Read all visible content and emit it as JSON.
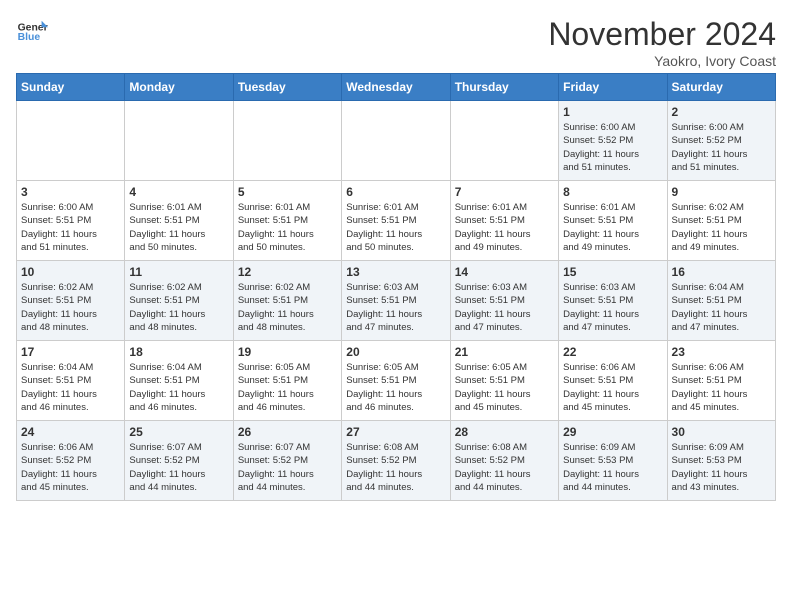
{
  "header": {
    "logo_line1": "General",
    "logo_line2": "Blue",
    "month": "November 2024",
    "location": "Yaokro, Ivory Coast"
  },
  "weekdays": [
    "Sunday",
    "Monday",
    "Tuesday",
    "Wednesday",
    "Thursday",
    "Friday",
    "Saturday"
  ],
  "weeks": [
    [
      {
        "day": "",
        "info": ""
      },
      {
        "day": "",
        "info": ""
      },
      {
        "day": "",
        "info": ""
      },
      {
        "day": "",
        "info": ""
      },
      {
        "day": "",
        "info": ""
      },
      {
        "day": "1",
        "info": "Sunrise: 6:00 AM\nSunset: 5:52 PM\nDaylight: 11 hours\nand 51 minutes."
      },
      {
        "day": "2",
        "info": "Sunrise: 6:00 AM\nSunset: 5:52 PM\nDaylight: 11 hours\nand 51 minutes."
      }
    ],
    [
      {
        "day": "3",
        "info": "Sunrise: 6:00 AM\nSunset: 5:51 PM\nDaylight: 11 hours\nand 51 minutes."
      },
      {
        "day": "4",
        "info": "Sunrise: 6:01 AM\nSunset: 5:51 PM\nDaylight: 11 hours\nand 50 minutes."
      },
      {
        "day": "5",
        "info": "Sunrise: 6:01 AM\nSunset: 5:51 PM\nDaylight: 11 hours\nand 50 minutes."
      },
      {
        "day": "6",
        "info": "Sunrise: 6:01 AM\nSunset: 5:51 PM\nDaylight: 11 hours\nand 50 minutes."
      },
      {
        "day": "7",
        "info": "Sunrise: 6:01 AM\nSunset: 5:51 PM\nDaylight: 11 hours\nand 49 minutes."
      },
      {
        "day": "8",
        "info": "Sunrise: 6:01 AM\nSunset: 5:51 PM\nDaylight: 11 hours\nand 49 minutes."
      },
      {
        "day": "9",
        "info": "Sunrise: 6:02 AM\nSunset: 5:51 PM\nDaylight: 11 hours\nand 49 minutes."
      }
    ],
    [
      {
        "day": "10",
        "info": "Sunrise: 6:02 AM\nSunset: 5:51 PM\nDaylight: 11 hours\nand 48 minutes."
      },
      {
        "day": "11",
        "info": "Sunrise: 6:02 AM\nSunset: 5:51 PM\nDaylight: 11 hours\nand 48 minutes."
      },
      {
        "day": "12",
        "info": "Sunrise: 6:02 AM\nSunset: 5:51 PM\nDaylight: 11 hours\nand 48 minutes."
      },
      {
        "day": "13",
        "info": "Sunrise: 6:03 AM\nSunset: 5:51 PM\nDaylight: 11 hours\nand 47 minutes."
      },
      {
        "day": "14",
        "info": "Sunrise: 6:03 AM\nSunset: 5:51 PM\nDaylight: 11 hours\nand 47 minutes."
      },
      {
        "day": "15",
        "info": "Sunrise: 6:03 AM\nSunset: 5:51 PM\nDaylight: 11 hours\nand 47 minutes."
      },
      {
        "day": "16",
        "info": "Sunrise: 6:04 AM\nSunset: 5:51 PM\nDaylight: 11 hours\nand 47 minutes."
      }
    ],
    [
      {
        "day": "17",
        "info": "Sunrise: 6:04 AM\nSunset: 5:51 PM\nDaylight: 11 hours\nand 46 minutes."
      },
      {
        "day": "18",
        "info": "Sunrise: 6:04 AM\nSunset: 5:51 PM\nDaylight: 11 hours\nand 46 minutes."
      },
      {
        "day": "19",
        "info": "Sunrise: 6:05 AM\nSunset: 5:51 PM\nDaylight: 11 hours\nand 46 minutes."
      },
      {
        "day": "20",
        "info": "Sunrise: 6:05 AM\nSunset: 5:51 PM\nDaylight: 11 hours\nand 46 minutes."
      },
      {
        "day": "21",
        "info": "Sunrise: 6:05 AM\nSunset: 5:51 PM\nDaylight: 11 hours\nand 45 minutes."
      },
      {
        "day": "22",
        "info": "Sunrise: 6:06 AM\nSunset: 5:51 PM\nDaylight: 11 hours\nand 45 minutes."
      },
      {
        "day": "23",
        "info": "Sunrise: 6:06 AM\nSunset: 5:51 PM\nDaylight: 11 hours\nand 45 minutes."
      }
    ],
    [
      {
        "day": "24",
        "info": "Sunrise: 6:06 AM\nSunset: 5:52 PM\nDaylight: 11 hours\nand 45 minutes."
      },
      {
        "day": "25",
        "info": "Sunrise: 6:07 AM\nSunset: 5:52 PM\nDaylight: 11 hours\nand 44 minutes."
      },
      {
        "day": "26",
        "info": "Sunrise: 6:07 AM\nSunset: 5:52 PM\nDaylight: 11 hours\nand 44 minutes."
      },
      {
        "day": "27",
        "info": "Sunrise: 6:08 AM\nSunset: 5:52 PM\nDaylight: 11 hours\nand 44 minutes."
      },
      {
        "day": "28",
        "info": "Sunrise: 6:08 AM\nSunset: 5:52 PM\nDaylight: 11 hours\nand 44 minutes."
      },
      {
        "day": "29",
        "info": "Sunrise: 6:09 AM\nSunset: 5:53 PM\nDaylight: 11 hours\nand 44 minutes."
      },
      {
        "day": "30",
        "info": "Sunrise: 6:09 AM\nSunset: 5:53 PM\nDaylight: 11 hours\nand 43 minutes."
      }
    ]
  ]
}
